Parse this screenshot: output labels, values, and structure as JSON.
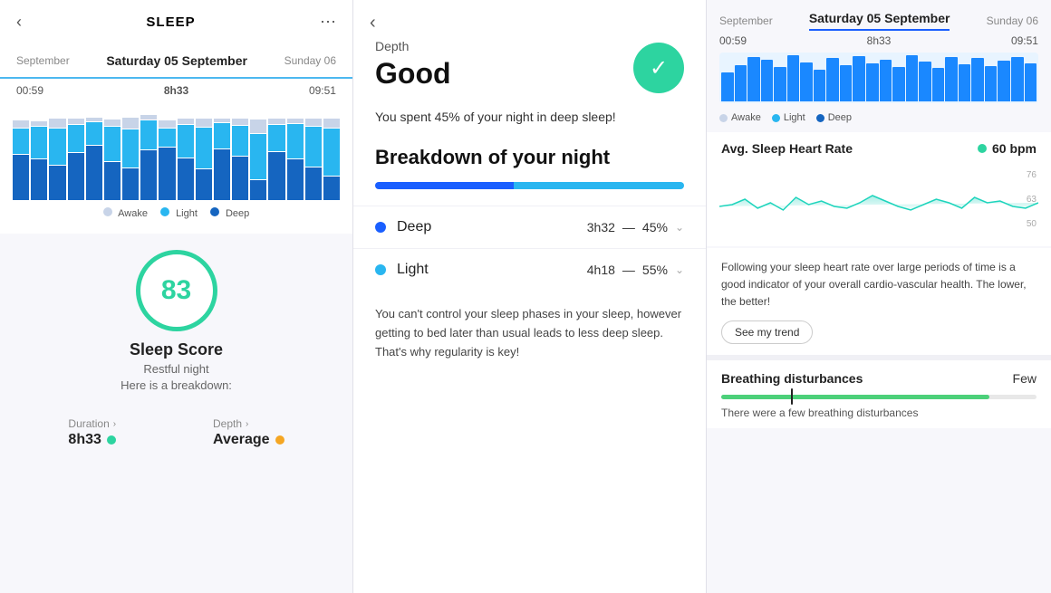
{
  "leftPanel": {
    "title": "SLEEP",
    "datePrev": "September",
    "dateCurrent": "Saturday 05 September",
    "dateNext": "Sunday 06",
    "timeStart": "00:59",
    "timeDuration": "8h33",
    "timeEnd": "09:51",
    "legend": {
      "awake": "Awake",
      "light": "Light",
      "deep": "Deep"
    },
    "score": {
      "value": "83",
      "title": "Sleep Score",
      "sub1": "Restful night",
      "sub2": "Here is a breakdown:"
    },
    "metrics": {
      "duration": {
        "label": "Duration",
        "value": "8h33",
        "dotColor": "#2dd4a0"
      },
      "depth": {
        "label": "Depth",
        "value": "Average",
        "dotColor": "#f5a623"
      }
    }
  },
  "middlePanel": {
    "depthLabel": "Depth",
    "depthValue": "Good",
    "deepSleepText": "You spent 45% of your night in deep sleep!",
    "breakdownTitle": "Breakdown of your night",
    "progressDeepPct": 45,
    "progressLightPct": 55,
    "phases": [
      {
        "name": "Deep",
        "dotColor": "#1a5fff",
        "time": "3h32",
        "pct": "45%"
      },
      {
        "name": "Light",
        "dotColor": "#29b6f0",
        "time": "4h18",
        "pct": "55%"
      }
    ],
    "adviceText": "You can't control your sleep phases in your sleep, however getting to bed later than usual leads to less deep sleep. That's why regularity is key!"
  },
  "rightPanel": {
    "datePrev": "September",
    "dateCurrent": "Saturday 05 September",
    "dateNext": "Sunday 06",
    "timeStart": "00:59",
    "timeDuration": "8h33",
    "timeEnd": "09:51",
    "legend": {
      "awake": "Awake",
      "light": "Light",
      "deep": "Deep"
    },
    "heartRate": {
      "label": "Avg. Sleep Heart Rate",
      "value": "60 bpm",
      "chartValues": [
        62,
        58,
        65,
        60,
        63,
        57,
        59,
        64,
        61,
        58,
        62,
        60,
        63,
        65,
        59,
        61,
        58,
        63,
        60,
        57,
        62,
        64,
        59,
        61
      ],
      "yLabels": [
        "76",
        "63",
        "50"
      ]
    },
    "heartRateAdvice": "Following your sleep heart rate over large periods of time is a good indicator of your overall cardio-vascular health. The lower, the better!",
    "trendBtn": "See my trend",
    "breathing": {
      "label": "Breathing disturbances",
      "value": "Few",
      "markerPct": 22,
      "desc": "There were a few breathing disturbances"
    }
  }
}
